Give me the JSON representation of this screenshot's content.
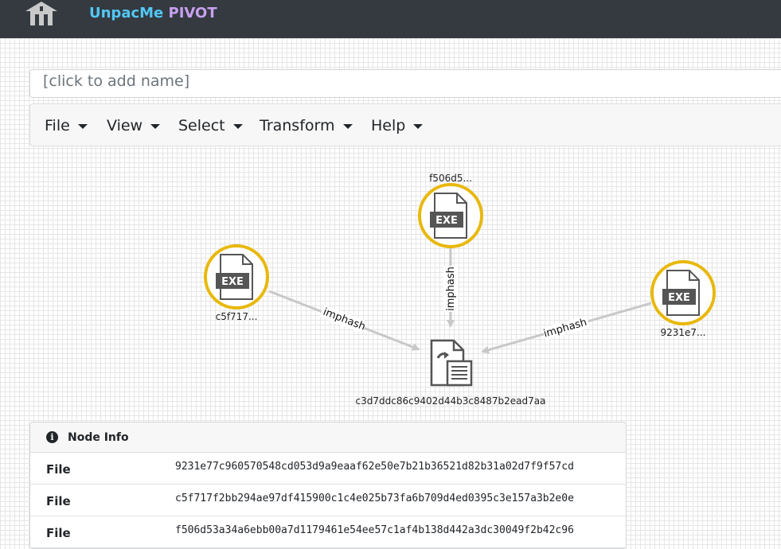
{
  "header": {
    "brand_part1": "UnpacMe",
    "brand_part2": "PIVOT",
    "logo_icon": "building-logo-icon"
  },
  "name_field": {
    "placeholder": "[click to add name]"
  },
  "menu": [
    {
      "label": "File"
    },
    {
      "label": "View"
    },
    {
      "label": "Select"
    },
    {
      "label": "Transform"
    },
    {
      "label": "Help"
    }
  ],
  "graph": {
    "nodes": [
      {
        "id": "f506",
        "label": "f506d5...",
        "kind": "exe",
        "icon": "exe-file-icon",
        "highlight_color": "#e8b80c"
      },
      {
        "id": "c5f7",
        "label": "c5f717...",
        "kind": "exe",
        "icon": "exe-file-icon",
        "highlight_color": "#e8b80c"
      },
      {
        "id": "9231",
        "label": "9231e7...",
        "kind": "exe",
        "icon": "exe-file-icon",
        "highlight_color": "#e8b80c"
      },
      {
        "id": "c3d7",
        "label": "c3d7ddc86c9402d44b3c8487b2ead7aa",
        "kind": "imphash",
        "icon": "imphash-document-icon"
      }
    ],
    "edges": [
      {
        "from": "f506",
        "to": "c3d7",
        "label": "imphash"
      },
      {
        "from": "c5f7",
        "to": "c3d7",
        "label": "imphash"
      },
      {
        "from": "9231",
        "to": "c3d7",
        "label": "imphash"
      }
    ],
    "exe_text": "EXE"
  },
  "info_panel": {
    "title": "Node Info",
    "icon": "info-icon",
    "rows": [
      {
        "key": "File",
        "value": "9231e77c960570548cd053d9a9eaaf62e50e7b21b36521d82b31a02d7f9f57cd"
      },
      {
        "key": "File",
        "value": "c5f717f2bb294ae97df415900c1c4e025b73fa6b709d4ed0395c3e157a3b2e0e"
      },
      {
        "key": "File",
        "value": "f506d53a34a6ebb00a7d1179461e54ee57c1af4b138d442a3dc30049f2b42c96"
      }
    ]
  }
}
